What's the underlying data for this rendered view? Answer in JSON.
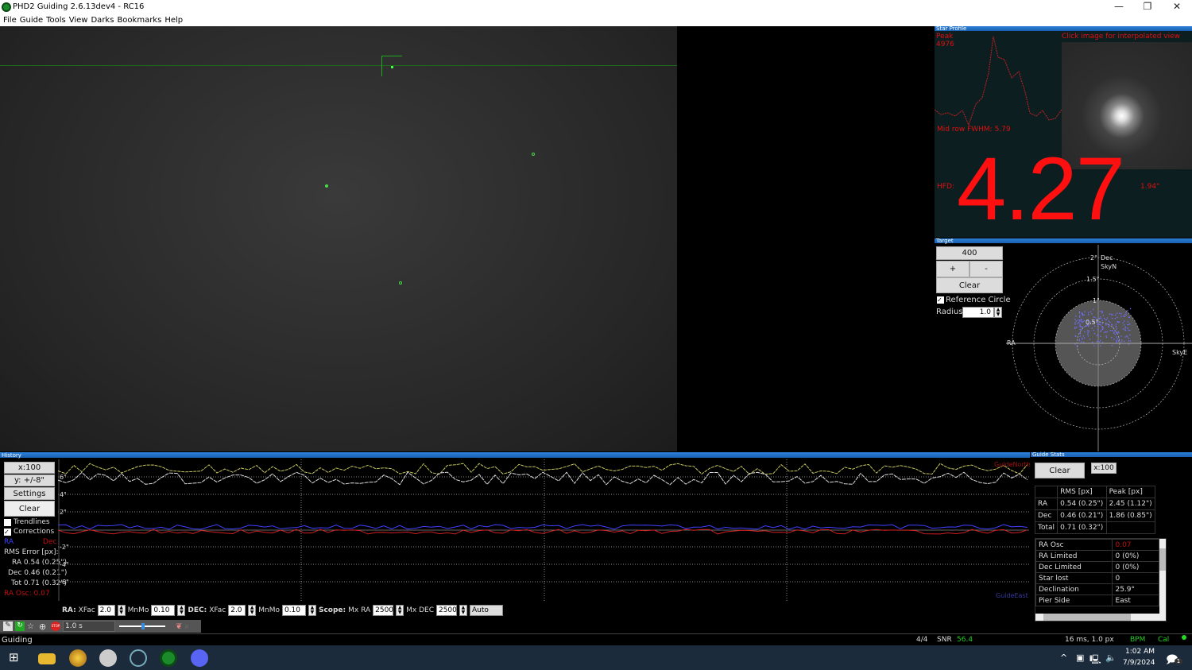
{
  "window": {
    "title": "PHD2 Guiding 2.6.13dev4 - RC16",
    "min": "—",
    "max": "❐",
    "close": "✕"
  },
  "menu": [
    "File",
    "Guide",
    "Tools",
    "View",
    "Darks",
    "Bookmarks",
    "Help"
  ],
  "profile": {
    "title": "Star Profile",
    "peak_label": "Peak",
    "peak": "4976",
    "hint": "Click image for interpolated view",
    "fwhm": "Mid row FWHM: 5.79",
    "hfd_label": "HFD:",
    "hfd": "4.27",
    "hfd_arcsec": "1.94\""
  },
  "target": {
    "title": "Target",
    "zoom": "400",
    "plus": "+",
    "minus": "-",
    "clear": "Clear",
    "ref_circle": "Reference Circle",
    "ref_checked": true,
    "radius_label": "Radius:",
    "radius": "1.0",
    "labels": {
      "dec": "Dec",
      "skyn": "SkyN",
      "ra": "RA",
      "skye": "SkyE",
      "r2": "2\"",
      "r15": "1.5\"",
      "r1": "1\"",
      "r05": "0.5\""
    }
  },
  "history": {
    "title": "History",
    "x_scale": "x:100",
    "y_scale": "y: +/-8\"",
    "settings": "Settings",
    "clear": "Clear",
    "trendlines": "Trendlines",
    "trendlines_checked": false,
    "corrections": "Corrections",
    "corrections_checked": true,
    "ra": "RA",
    "dec": "Dec",
    "rms_title": "RMS Error [px]:",
    "rms_ra": "RA 0.54 (0.25\")",
    "rms_dec": "Dec 0.46 (0.21\")",
    "rms_tot": "Tot 0.71 (0.32\")",
    "ra_osc": "RA Osc: 0.07",
    "y_ticks": [
      "6\"",
      "4\"",
      "2\"",
      "-2\"",
      "-4\"",
      "-6\""
    ],
    "guide_north": "GuideNorth",
    "guide_east": "GuideEast",
    "colors": {
      "ra": "#4040ff",
      "dec": "#e02020"
    }
  },
  "controls": {
    "ra_label": "RA:",
    "xfac": "XFac",
    "ra_xfac": "2.0",
    "mnmo": "MnMo",
    "ra_mnmo": "0.10",
    "dec_label": "DEC:",
    "dec_xfac": "2.0",
    "dec_mnmo": "0.10",
    "scope_label": "Scope:",
    "mxra_label": "Mx RA",
    "mx_ra": "2500",
    "mxdec_label": "Mx DEC",
    "mx_dec": "2500",
    "dec_mode": "Auto",
    "exposure": "1.0 s"
  },
  "stats": {
    "title": "Guide Stats",
    "clear": "Clear",
    "x_scale": "x:100",
    "headers": [
      "",
      "RMS [px]",
      "Peak [px]"
    ],
    "rows": [
      [
        "RA",
        "0.54 (0.25\")",
        "2.45 (1.12\")"
      ],
      [
        "Dec",
        "0.46 (0.21\")",
        "1.86 (0.85\")"
      ],
      [
        "Total",
        "0.71 (0.32\")",
        ""
      ]
    ],
    "info": [
      [
        "RA Osc",
        "0.07"
      ],
      [
        "RA Limited",
        "0 (0%)"
      ],
      [
        "Dec Limited",
        "0 (0%)"
      ],
      [
        "Star lost",
        "0"
      ],
      [
        "Declination",
        "25.9°"
      ],
      [
        "Pier Side",
        "East"
      ]
    ]
  },
  "status": {
    "state": "Guiding",
    "frames": "4/4",
    "snr_label": "SNR",
    "snr": "56.4",
    "timing": "16 ms, 1.0 px",
    "bpm": "BPM",
    "cal": "Cal"
  },
  "taskbar": {
    "time": "1:02 AM",
    "date": "7/9/2024",
    "notif": "1"
  }
}
